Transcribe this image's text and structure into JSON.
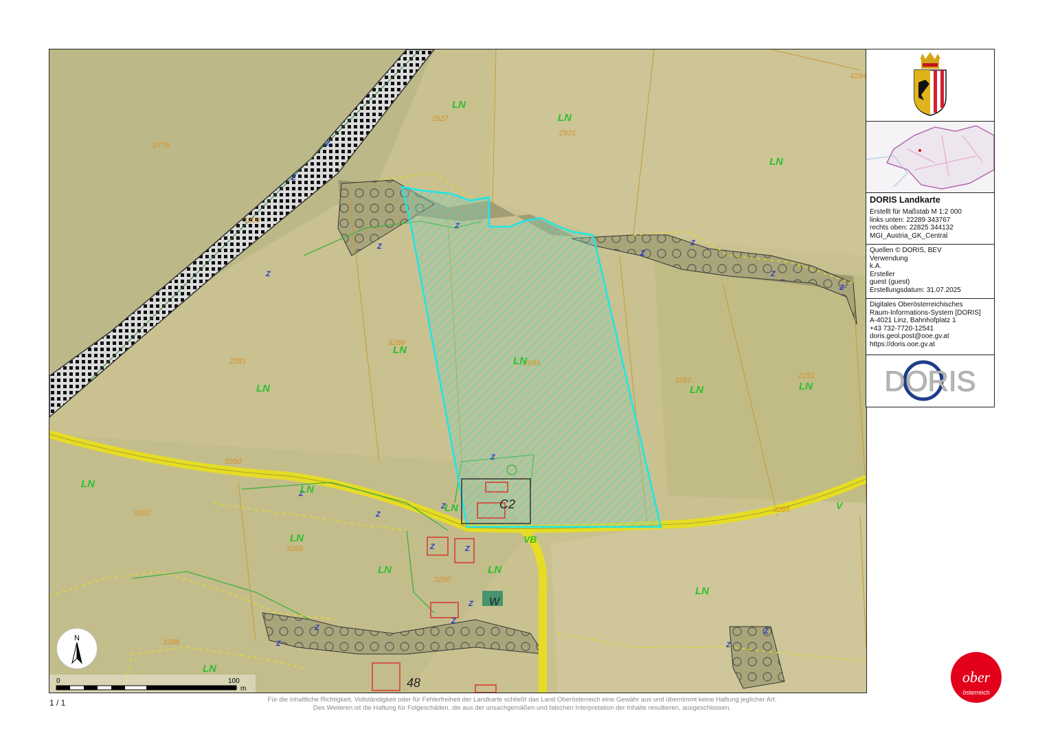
{
  "map": {
    "land_use_label": "LN",
    "road_labels": [
      "V",
      "VB"
    ],
    "zoning_labels": [
      "C2",
      "W",
      "48"
    ],
    "parcel_numbers": [
      "2779",
      "2927",
      "2921",
      "3200",
      "2281",
      "3288",
      "2935",
      "3287",
      "2291",
      "3380",
      "3292",
      "3286",
      "3290",
      "3285",
      "3281",
      "3288",
      "4294"
    ]
  },
  "scale_bar": {
    "start_label": "0",
    "end_label": "100",
    "unit": "m"
  },
  "north_arrow": {
    "label": "N"
  },
  "panel": {
    "title": "DORIS Landkarte",
    "scale": "Erstellt für Maßstab M 1:2 000",
    "lower_left": "links unten: 22289 343767",
    "upper_right": "rechts oben: 22825 344132",
    "crs": "MGI_Austria_GK_Central",
    "sources": "Quellen © DORIS, BEV",
    "usage_label": "Verwendung",
    "usage_value": "k.A.",
    "creator_label": "Ersteller",
    "creator_value": "guest (guest)",
    "created_date": "Erstellungsdatum: 31.07.2025",
    "org_line1": "Digitales Oberösterreichisches",
    "org_line2": "Raum-Informations-System [DORIS]",
    "address": "A-4021 Linz, Bahnhofplatz 1",
    "phone": "+43 732-7720-12541",
    "email": "doris.geol.post@ooe.gv.at",
    "website": "https://doris.ooe.gv.at",
    "logo_text": "DORIS"
  },
  "page_number": "1 / 1",
  "disclaimer_line1": "Für die inhaltliche Richtigkeit, Vollständigkeit oder für Fehlerfreiheit der Landkarte schließt das Land Oberösterreich eine Gewähr aus und übernimmt keine Haftung jeglicher Art.",
  "disclaimer_line2": "Des Weiteren ist die Haftung für Folgeschäden, die aus der unsachgemäßen und falschen Interpretation der Inhalte resultieren, ausgeschlossen.",
  "badge": {
    "main": "ober",
    "sub": "österreich"
  },
  "colors": {
    "accent_red": "#e3001b",
    "selection_cyan": "#1ee6e6",
    "road_yellow": "#f2e21a",
    "land_use_green": "#2fbf2f",
    "parcel_orange": "#d4902a"
  }
}
